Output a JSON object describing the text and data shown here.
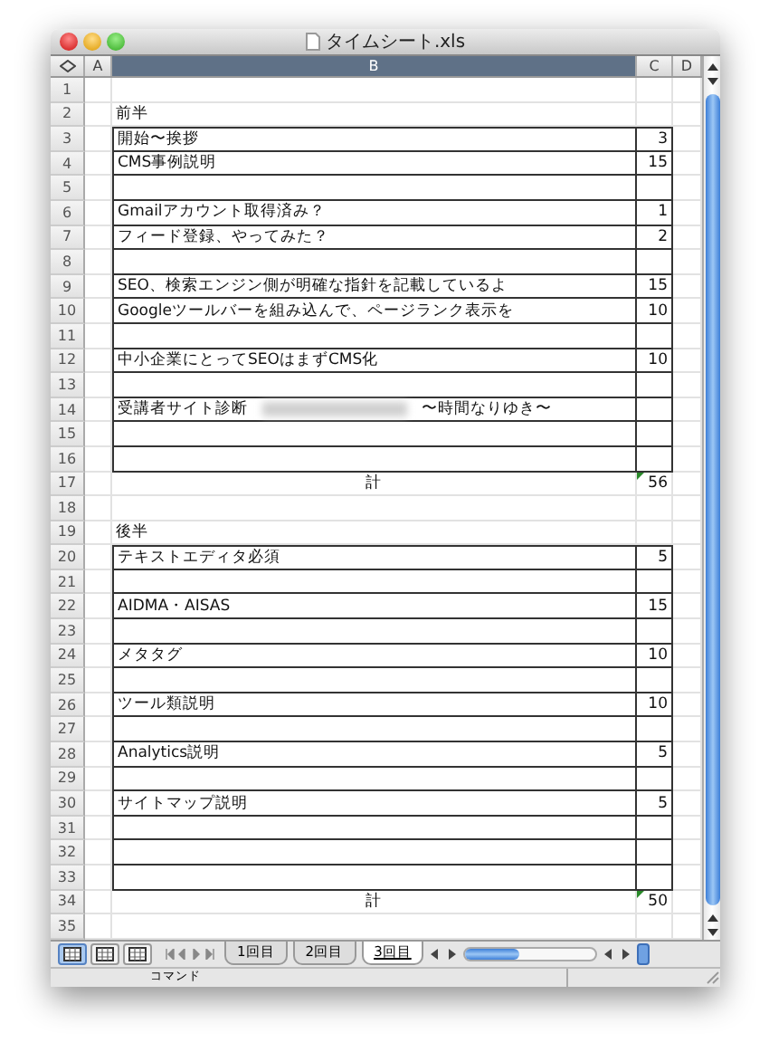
{
  "window": {
    "title": "タイムシート.xls"
  },
  "columns": [
    {
      "label": "A",
      "selected": false
    },
    {
      "label": "B",
      "selected": true
    },
    {
      "label": "C",
      "selected": false
    },
    {
      "label": "D",
      "selected": false
    }
  ],
  "rows": [
    {
      "num": "1",
      "kind": "plain",
      "b": "",
      "c": ""
    },
    {
      "num": "2",
      "kind": "plain",
      "b": "前半",
      "c": ""
    },
    {
      "num": "3",
      "kind": "boxed",
      "b": "開始〜挨拶",
      "c": "3"
    },
    {
      "num": "4",
      "kind": "boxed",
      "b": "CMS事例説明",
      "c": "15"
    },
    {
      "num": "5",
      "kind": "boxed",
      "b": "",
      "c": ""
    },
    {
      "num": "6",
      "kind": "boxed",
      "b": "Gmailアカウント取得済み？",
      "c": "1"
    },
    {
      "num": "7",
      "kind": "boxed",
      "b": "フィード登録、やってみた？",
      "c": "2"
    },
    {
      "num": "8",
      "kind": "boxed",
      "b": "",
      "c": ""
    },
    {
      "num": "9",
      "kind": "boxed",
      "b": "SEO、検索エンジン側が明確な指針を記載しているよ",
      "c": "15"
    },
    {
      "num": "10",
      "kind": "boxed",
      "b": "Googleツールバーを組み込んで、ページランク表示を",
      "c": "10"
    },
    {
      "num": "11",
      "kind": "boxed",
      "b": "",
      "c": ""
    },
    {
      "num": "12",
      "kind": "boxed",
      "b": "中小企業にとってSEOはまずCMS化",
      "c": "10"
    },
    {
      "num": "13",
      "kind": "boxed",
      "b": "",
      "c": ""
    },
    {
      "num": "14",
      "kind": "boxed",
      "b": "受講者サイト診断",
      "b_tail": "〜時間なりゆき〜",
      "c": ""
    },
    {
      "num": "15",
      "kind": "boxed",
      "b": "",
      "c": ""
    },
    {
      "num": "16",
      "kind": "boxed",
      "b": "",
      "c": ""
    },
    {
      "num": "17",
      "kind": "total",
      "b": "計",
      "c": "56",
      "flagged": true
    },
    {
      "num": "18",
      "kind": "plain",
      "b": "",
      "c": ""
    },
    {
      "num": "19",
      "kind": "plain",
      "b": "後半",
      "c": ""
    },
    {
      "num": "20",
      "kind": "boxed",
      "b": "テキストエディタ必須",
      "c": "5"
    },
    {
      "num": "21",
      "kind": "boxed",
      "b": "",
      "c": ""
    },
    {
      "num": "22",
      "kind": "boxed",
      "b": "AIDMA・AISAS",
      "c": "15"
    },
    {
      "num": "23",
      "kind": "boxed",
      "b": "",
      "c": ""
    },
    {
      "num": "24",
      "kind": "boxed",
      "b": "メタタグ",
      "c": "10"
    },
    {
      "num": "25",
      "kind": "boxed",
      "b": "",
      "c": ""
    },
    {
      "num": "26",
      "kind": "boxed",
      "b": "ツール類説明",
      "c": "10"
    },
    {
      "num": "27",
      "kind": "boxed",
      "b": "",
      "c": ""
    },
    {
      "num": "28",
      "kind": "boxed",
      "b": "Analytics説明",
      "c": "5"
    },
    {
      "num": "29",
      "kind": "boxed",
      "b": "",
      "c": ""
    },
    {
      "num": "30",
      "kind": "boxed",
      "b": "サイトマップ説明",
      "c": "5"
    },
    {
      "num": "31",
      "kind": "boxed",
      "b": "",
      "c": ""
    },
    {
      "num": "32",
      "kind": "boxed",
      "b": "",
      "c": ""
    },
    {
      "num": "33",
      "kind": "boxed",
      "b": "",
      "c": ""
    },
    {
      "num": "34",
      "kind": "total",
      "b": "計",
      "c": "50",
      "flagged": true
    },
    {
      "num": "35",
      "kind": "plain",
      "b": "",
      "c": ""
    }
  ],
  "view_buttons": [
    {
      "selected": true
    },
    {
      "selected": false
    },
    {
      "selected": false
    }
  ],
  "sheet_tabs": [
    {
      "label": "1回目",
      "selected": false
    },
    {
      "label": "2回目",
      "selected": false
    },
    {
      "label": "3回目",
      "selected": true
    }
  ],
  "status_bar": {
    "text": "コマンド"
  }
}
